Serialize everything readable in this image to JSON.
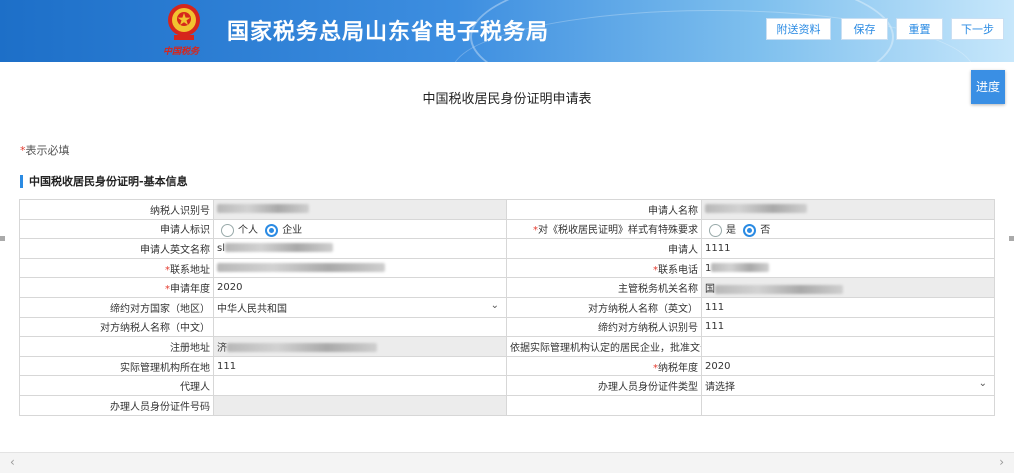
{
  "header": {
    "emblem_text": "中国税务",
    "title": "国家税务总局山东省电子税务局",
    "buttons": {
      "attach": "附送资料",
      "save": "保存",
      "reset": "重置",
      "next": "下一步"
    }
  },
  "form_title": "中国税收居民身份证明申请表",
  "progress_label": "进度",
  "required_note": {
    "star": "*",
    "text": "表示必填"
  },
  "section_title": "中国税收居民身份证明-基本信息",
  "fields": {
    "taxpayer_id": {
      "label": "纳税人识别号"
    },
    "applicant_name": {
      "label": "申请人名称"
    },
    "applicant_type": {
      "label": "申请人标识",
      "opt1": "个人",
      "opt2": "企业",
      "selected": "企业"
    },
    "special_format": {
      "label": "对《税收居民证明》样式有特殊要求",
      "opt1": "是",
      "opt2": "否",
      "selected": "否"
    },
    "english_name": {
      "label": "申请人英文名称",
      "value": "sl"
    },
    "applicant": {
      "label": "申请人",
      "value": "1111"
    },
    "address": {
      "label": "联系地址"
    },
    "phone": {
      "label": "联系电话",
      "value": "1"
    },
    "year": {
      "label": "申请年度",
      "value": "2020"
    },
    "tax_authority": {
      "label": "主管税务机关名称",
      "value": "国"
    },
    "country": {
      "label": "缔约对方国家（地区）",
      "value": "中华人民共和国"
    },
    "counterpart_en": {
      "label": "对方纳税人名称（英文）",
      "value": "111"
    },
    "counterpart_cn": {
      "label": "对方纳税人名称（中文）",
      "value": ""
    },
    "counterpart_id": {
      "label": "缔约对方纳税人识别号",
      "value": "111"
    },
    "reg_address": {
      "label": "注册地址",
      "value": "济"
    },
    "approval_no": {
      "label": "依据实际管理机构认定的居民企业，批准文号",
      "value": ""
    },
    "mgmt_location": {
      "label": "实际管理机构所在地",
      "value": "111"
    },
    "tax_year": {
      "label": "纳税年度",
      "value": "2020"
    },
    "agent": {
      "label": "代理人",
      "value": ""
    },
    "handler_id_type": {
      "label": "办理人员身份证件类型",
      "value": "请选择"
    },
    "handler_id_no": {
      "label": "办理人员身份证件号码",
      "value": ""
    }
  },
  "colors": {
    "accent": "#2b8be3",
    "required": "#e53b2f",
    "header_start": "#1d6fc8"
  }
}
